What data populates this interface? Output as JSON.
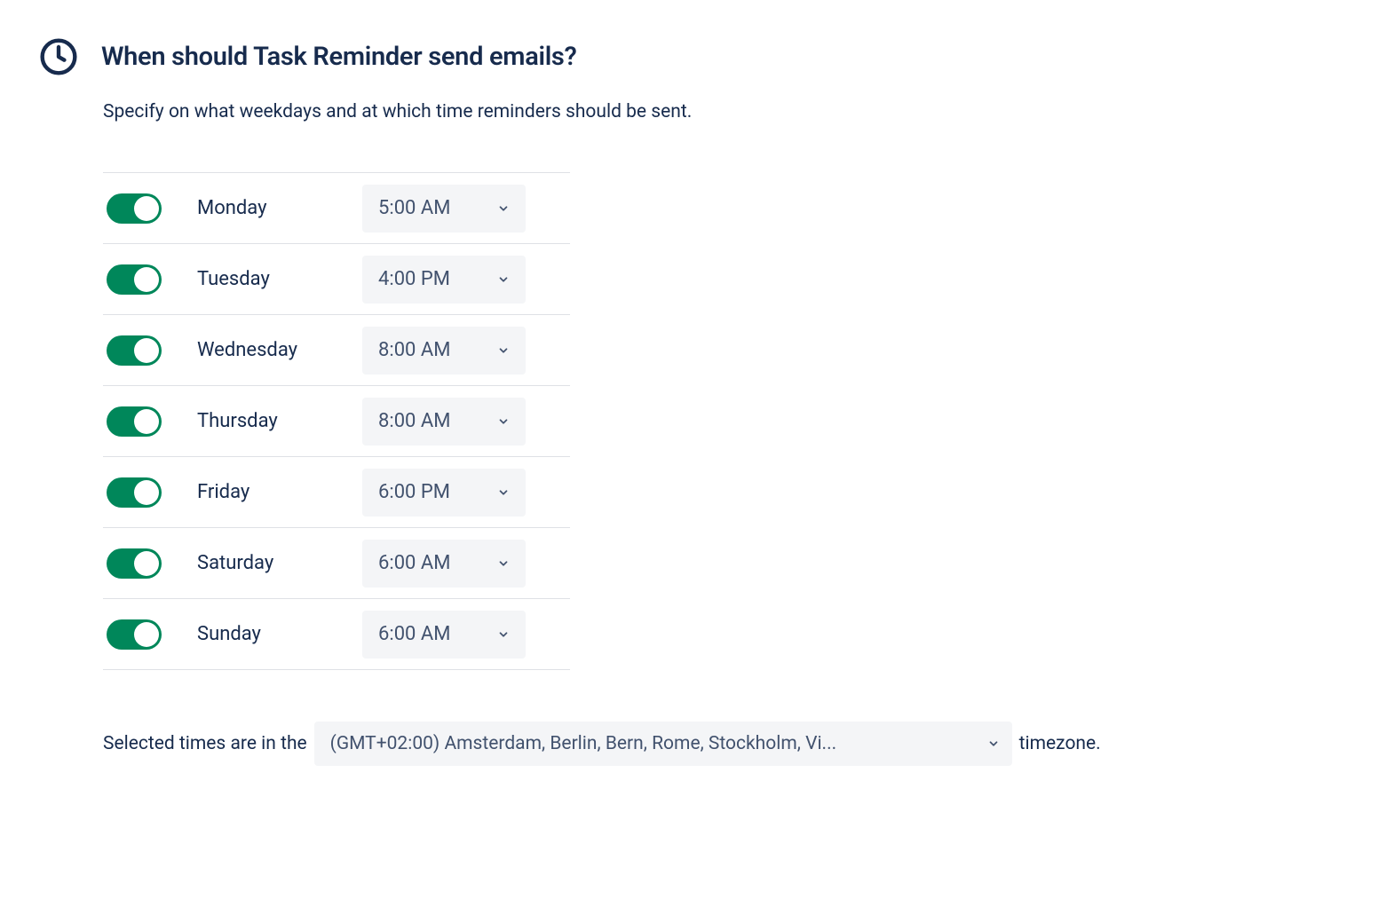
{
  "header": {
    "title": "When should Task Reminder send emails?"
  },
  "description": "Specify on what weekdays and at which time reminders should be sent.",
  "schedule": [
    {
      "day": "Monday",
      "enabled": true,
      "time": "5:00 AM"
    },
    {
      "day": "Tuesday",
      "enabled": true,
      "time": "4:00 PM"
    },
    {
      "day": "Wednesday",
      "enabled": true,
      "time": "8:00 AM"
    },
    {
      "day": "Thursday",
      "enabled": true,
      "time": "8:00 AM"
    },
    {
      "day": "Friday",
      "enabled": true,
      "time": "6:00 PM"
    },
    {
      "day": "Saturday",
      "enabled": true,
      "time": "6:00 AM"
    },
    {
      "day": "Sunday",
      "enabled": true,
      "time": "6:00 AM"
    }
  ],
  "timezone": {
    "prefix": "Selected times are in the",
    "value": "(GMT+02:00) Amsterdam, Berlin, Bern, Rome, Stockholm, Vi...",
    "suffix": "timezone."
  }
}
